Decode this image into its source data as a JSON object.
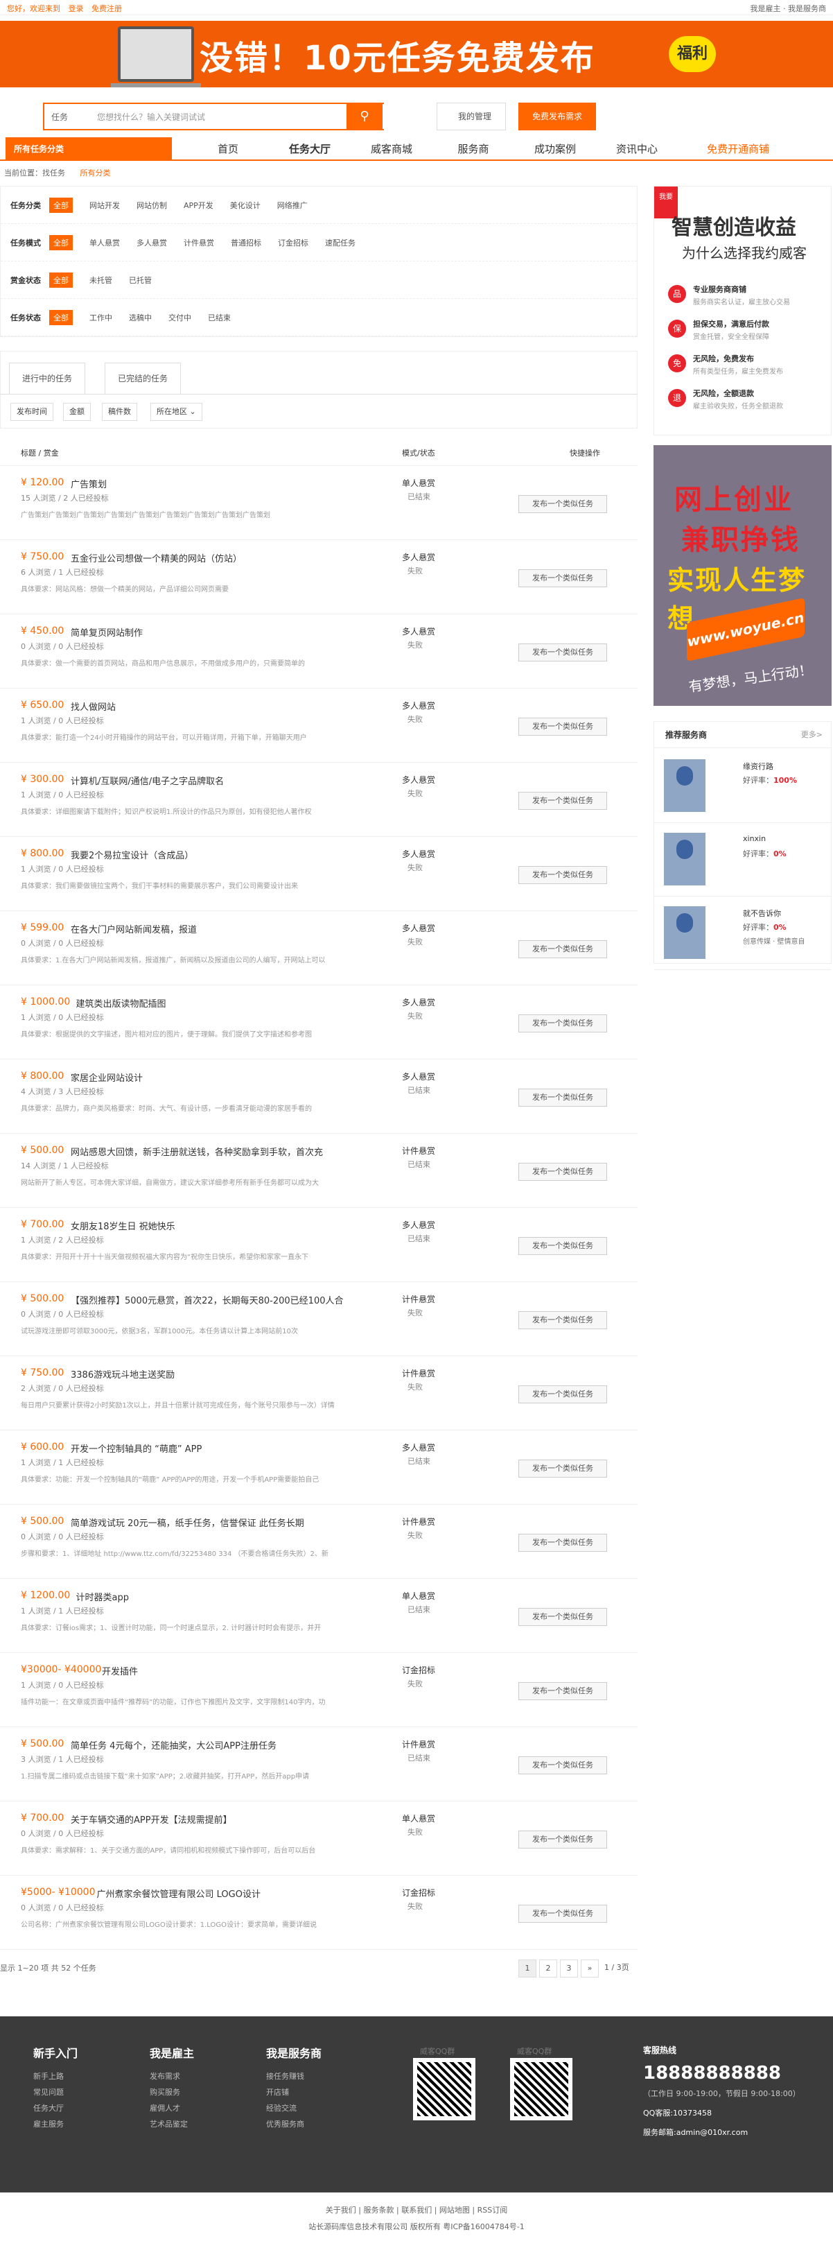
{
  "topbar": {
    "left_links": [
      "您好，欢迎来到",
      "登录",
      "免费注册"
    ],
    "right": "我是雇主 · 我是服务商"
  },
  "banner": {
    "text": "没错！10元任务免费发布",
    "badge": "福利"
  },
  "search": {
    "category": "任务",
    "placeholder": "您想找什么？输入关键词试试",
    "my_manage": "我的管理",
    "publish": "免费发布需求"
  },
  "nav": {
    "all_categories": "所有任务分类",
    "items": [
      "首页",
      "任务大厅",
      "威客商城",
      "服务商",
      "成功案例",
      "资讯中心"
    ],
    "vip": "免费开通商铺"
  },
  "crumb": {
    "label": "当前位置：找任务",
    "current": "所有分类"
  },
  "filters": [
    {
      "label": "任务分类",
      "selected": "全部",
      "options": [
        "网站开发",
        "网站仿制",
        "APP开发",
        "美化设计",
        "网络推广"
      ]
    },
    {
      "label": "任务模式",
      "selected": "全部",
      "options": [
        "单人悬赏",
        "多人悬赏",
        "计件悬赏",
        "普通招标",
        "订金招标",
        "速配任务"
      ]
    },
    {
      "label": "赏金状态",
      "selected": "全部",
      "options": [
        "未托管",
        "已托管"
      ]
    },
    {
      "label": "任务状态",
      "selected": "全部",
      "options": [
        "工作中",
        "选稿中",
        "交付中",
        "已结束"
      ]
    }
  ],
  "tabs": [
    "进行中的任务",
    "已完结的任务"
  ],
  "sorts": [
    "发布时间",
    "金额",
    "稿件数",
    "所在地区"
  ],
  "table_head": {
    "title": "标题 / 赏金",
    "mode": "模式/状态",
    "action": "快捷操作"
  },
  "tasks": [
    {
      "price": "¥ 120.00",
      "title": "广告策划",
      "meta": "15 人浏览 / 2 人已经投标",
      "desc": "广告策划广告策划广告策划广告策划广告策划广告策划广告策划广告策划广告策划",
      "mode": "单人悬赏",
      "state": "已结束",
      "btn": "发布一个类似任务"
    },
    {
      "price": "¥ 750.00",
      "title": "五金行业公司想做一个精美的网站（仿站）",
      "meta": "6 人浏览 / 1 人已经投标",
      "desc": "具体要求：网站风格：想做一个精美的网站，产品详细公司网页需要",
      "mode": "多人悬赏",
      "state": "失败",
      "btn": "发布一个类似任务"
    },
    {
      "price": "¥ 450.00",
      "title": "简单复页网站制作",
      "meta": "0 人浏览 / 0 人已经投标",
      "desc": "具体要求：做一个需要的首页网站，商品和用户信息展示，不用做成多用户的，只需要简单的",
      "mode": "多人悬赏",
      "state": "失败",
      "btn": "发布一个类似任务"
    },
    {
      "price": "¥ 650.00",
      "title": "找人做网站",
      "meta": "1 人浏览 / 0 人已经投标",
      "desc": "具体要求：能打造一个24小时开箱操作的网站平台，可以开箱详用，开箱下单，开箱聊天用户",
      "mode": "多人悬赏",
      "state": "失败",
      "btn": "发布一个类似任务"
    },
    {
      "price": "¥ 300.00",
      "title": "计算机/互联网/通信/电子之字品牌取名",
      "meta": "1 人浏览 / 0 人已经投标",
      "desc": "具体要求：详细图案请下载附件；知识产权说明1.所设计的作品只为原创，如有侵犯他人著作权",
      "mode": "多人悬赏",
      "state": "失败",
      "btn": "发布一个类似任务"
    },
    {
      "price": "¥ 800.00",
      "title": "我要2个易拉宝设计（含成品）",
      "meta": "1 人浏览 / 0 人已经投标",
      "desc": "具体要求：我们需要做镜拉宝两个，我们干事材料的需要展示客户，我们公司需要设计出来",
      "mode": "多人悬赏",
      "state": "失败",
      "btn": "发布一个类似任务"
    },
    {
      "price": "¥ 599.00",
      "title": "在各大门户网站新闻发稿，报道",
      "meta": "0 人浏览 / 0 人已经投标",
      "desc": "具体要求：1.在各大门户网站新闻发稿，报道推广，新闻稿以及报道由公司的人编写，开网站上可以",
      "mode": "多人悬赏",
      "state": "失败",
      "btn": "发布一个类似任务"
    },
    {
      "price": "¥ 1000.00",
      "title": "建筑类出版读物配插图",
      "meta": "1 人浏览 / 0 人已经投标",
      "desc": "具体要求：根据提供的文字描述，图片相对应的图片，便于理解。我们提供了文字描述和参考图",
      "mode": "多人悬赏",
      "state": "失败",
      "btn": "发布一个类似任务"
    },
    {
      "price": "¥ 800.00",
      "title": "家居企业网站设计",
      "meta": "4 人浏览 / 3 人已经投标",
      "desc": "具体要求：品牌力，商户类风格要求：时尚、大气、有设计感，一步看清牙能动漫的家居手看的",
      "mode": "多人悬赏",
      "state": "已结束",
      "btn": "发布一个类似任务"
    },
    {
      "price": "¥ 500.00",
      "title": "网站感恩大回馈，新手注册就送钱，各种奖励拿到手软，首次充",
      "meta": "14 人浏览 / 1 人已经投标",
      "desc": "网站新开了新人专区，可本佣大家详细，自需做方，建议大家详细参考所有新手任务都可以成为大",
      "mode": "计件悬赏",
      "state": "已结束",
      "btn": "发布一个类似任务"
    },
    {
      "price": "¥ 700.00",
      "title": "女朋友18岁生日 祝她快乐",
      "meta": "1 人浏览 / 2 人已经投标",
      "desc": "具体要求：开阳开十开十十当天做视频祝福大家内容为“祝你生日快乐，希望你和家家一直永下",
      "mode": "多人悬赏",
      "state": "已结束",
      "btn": "发布一个类似任务"
    },
    {
      "price": "¥ 500.00",
      "title": "【强烈推荐】5000元悬赏，首次22，长期每天80-200已经100人合",
      "meta": "0 人浏览 / 0 人已经投标",
      "desc": "试玩游戏注册即可领取3000元，依据3名，军群1000元。本任务请以计算上本网站前10次",
      "mode": "计件悬赏",
      "state": "失败",
      "btn": "发布一个类似任务"
    },
    {
      "price": "¥ 750.00",
      "title": "3386游戏玩斗地主送奖励",
      "meta": "2 人浏览 / 0 人已经投标",
      "desc": "每日用户只要累计获得2小时奖励1次以上，并且十倍累计就可完成任务，每个账号只限参与一次）详情",
      "mode": "计件悬赏",
      "state": "失败",
      "btn": "发布一个类似任务"
    },
    {
      "price": "¥ 600.00",
      "title": "开发一个控制轴具的 “萌鹿” APP",
      "meta": "1 人浏览 / 1 人已经投标",
      "desc": "具体要求：功能：开发一个控制轴具的“萌鹿” APP的APP的用途，开发一个手机APP需要能拍自己",
      "mode": "多人悬赏",
      "state": "已结束",
      "btn": "发布一个类似任务"
    },
    {
      "price": "¥ 500.00",
      "title": "简单游戏试玩 20元一稿，纸手任务，信誉保证 此任务长期",
      "meta": "0 人浏览 / 0 人已经投标",
      "desc": "步骤和要求：1、详细地址 http://www.ttz.com/fd/32253480 334 （不要合格请任务失败）2、新",
      "mode": "计件悬赏",
      "state": "失败",
      "btn": "发布一个类似任务"
    },
    {
      "price": "¥ 1200.00",
      "title": "计时器类app",
      "meta": "1 人浏览 / 1 人已经投标",
      "desc": "具体要求：订餐ios需求；1、设置计时功能，同一个时速点显示，2. 计时器计时时会有提示，并开",
      "mode": "单人悬赏",
      "state": "已结束",
      "btn": "发布一个类似任务"
    },
    {
      "price": "¥30000- ¥40000",
      "title": "开发插件",
      "meta": "1 人浏览 / 0 人已经投标",
      "desc": "插件功能一：在文章或页面中插件“推荐码”的功能，订作也下推图片及文字，文字限制140字内，功",
      "mode": "订金招标",
      "state": "失败",
      "btn": "发布一个类似任务"
    },
    {
      "price": "¥ 500.00",
      "title": "简单任务 4元每个，还能抽奖，大公司APP注册任务",
      "meta": "3 人浏览 / 1 人已经投标",
      "desc": "1.扫描专属二维码或点击链接下载“来十如家”APP；2.收藏并抽奖，打开APP，然后开app申请",
      "mode": "计件悬赏",
      "state": "已结束",
      "btn": "发布一个类似任务"
    },
    {
      "price": "¥ 700.00",
      "title": "关于车辆交通的APP开发【法规需提前】",
      "meta": "0 人浏览 / 0 人已经投标",
      "desc": "具体要求：需求解释：1、关于交通方面的APP，请同相机和视频模式下操作即可，后台可以后台",
      "mode": "单人悬赏",
      "state": "失败",
      "btn": "发布一个类似任务"
    },
    {
      "price": "¥5000- ¥10000",
      "title": "广州煮家余餐饮管理有限公司 LOGO设计",
      "meta": "0 人浏览 / 0 人已经投标",
      "desc": "公司名称：广州煮家余餐饮管理有限公司LOGO设计要求：1.LOGO设计：要求简单，需要详细说",
      "mode": "订金招标",
      "state": "失败",
      "btn": "发布一个类似任务"
    }
  ],
  "pager": {
    "info": "显示 1~20 项 共 52 个任务",
    "pages": [
      "1",
      "2",
      "3",
      "»"
    ],
    "total": "1 / 3页"
  },
  "promo1": {
    "tag": "我要",
    "h1": "智慧创造收益",
    "h2": "为什么选择我约威客",
    "items": [
      {
        "icon": "品",
        "t": "专业服务商商铺",
        "d": "服务商实名认证，雇主放心交易"
      },
      {
        "icon": "保",
        "t": "担保交易，满意后付款",
        "d": "赏金托管，安全全程保障"
      },
      {
        "icon": "免",
        "t": "无风险，免费发布",
        "d": "所有类型任务，雇主免费发布"
      },
      {
        "icon": "退",
        "t": "无风险，全额退款",
        "d": "雇主验收失败，任务全额退款"
      }
    ]
  },
  "promo2": {
    "l1": "网上创业",
    "l2": "兼职挣钱",
    "l3": "实现人生梦想",
    "key": "www.woyue.cn",
    "slogan": "有梦想，马上行动！"
  },
  "recommend": {
    "title": "推荐服务商",
    "more": "更多>",
    "items": [
      {
        "name": "缘资行路",
        "rate_label": "好评率：",
        "rate": "100%",
        "extra": ""
      },
      {
        "name": "xinxin",
        "rate_label": "好评率：",
        "rate": "0%",
        "extra": ""
      },
      {
        "name": "就不告诉你",
        "rate_label": "好评率：",
        "rate": "0%",
        "extra": "创意传媒 · 壁情意自"
      }
    ]
  },
  "footer": {
    "cols": [
      {
        "h": "新手入门",
        "items": [
          "新手上路",
          "常见问题",
          "任务大厅",
          "雇主服务"
        ]
      },
      {
        "h": "我是雇主",
        "items": [
          "发布需求",
          "购买服务",
          "雇佣人才",
          "艺术品鉴定"
        ]
      },
      {
        "h": "我是服务商",
        "items": [
          "接任务赚钱",
          "开店铺",
          "经验交流",
          "优秀服务商"
        ]
      }
    ],
    "qr1": "威客QQ群",
    "qr2": "威客QQ群",
    "hotline": "客服热线",
    "tel": "18888888888",
    "hours": "（工作日 9:00-19:00，节假日 9:00-18:00）",
    "qq": "QQ客服:10373458",
    "mail": "服务邮箱:admin@010xr.com"
  },
  "copyright": {
    "links": "关于我们 | 服务条款 | 联系我们 | 网站地图 | RSS订阅",
    "text": "站长源码库信息技术有限公司 版权所有  粤ICP备16004784号-1"
  }
}
